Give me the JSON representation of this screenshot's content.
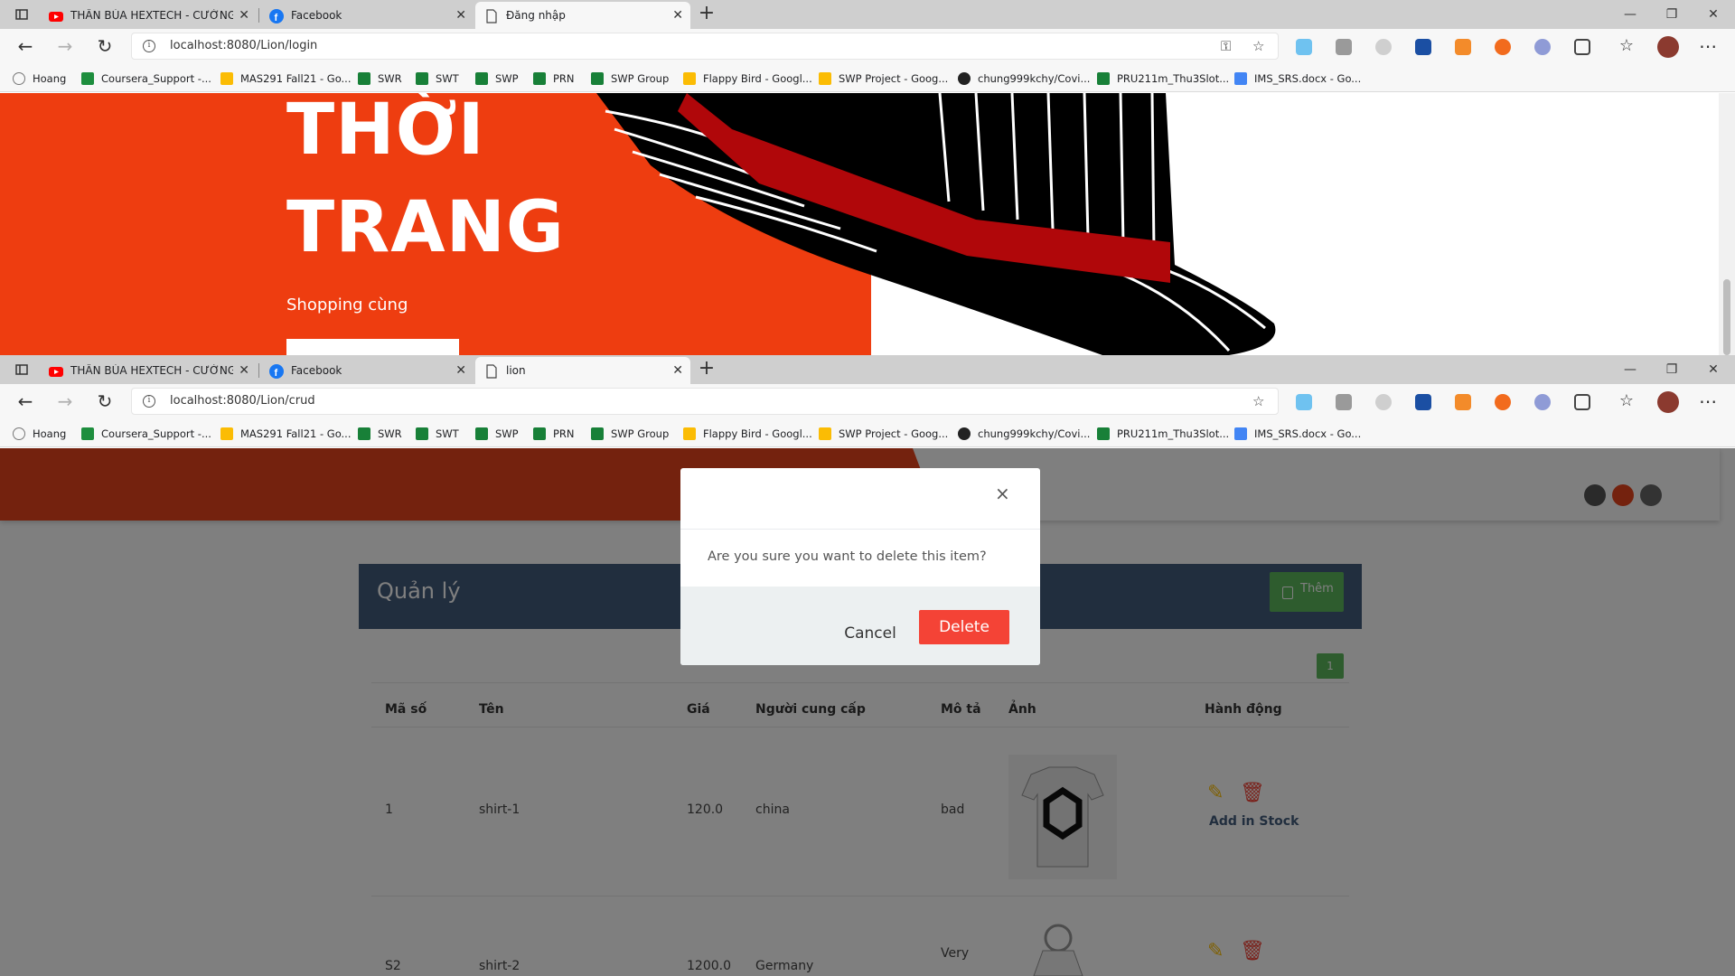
{
  "window1": {
    "tabs": [
      {
        "title": "THẦN BÚA HEXTECH - CƯỜNG ...",
        "icon": "youtube-icon"
      },
      {
        "title": "Facebook",
        "icon": "facebook-icon"
      },
      {
        "title": "Đăng nhập",
        "icon": "page-icon",
        "active": true
      }
    ],
    "url": "localhost:8080/Lion/login",
    "hero": {
      "line1": "THỜI",
      "line2": "TRANG",
      "subtitle": "Shopping cùng"
    }
  },
  "window2": {
    "tabs": [
      {
        "title": "THẦN BÚA HEXTECH - CƯỜNG ...",
        "icon": "youtube-icon"
      },
      {
        "title": "Facebook",
        "icon": "facebook-icon"
      },
      {
        "title": "lion",
        "icon": "page-icon",
        "active": true
      }
    ],
    "url": "localhost:8080/Lion/crud",
    "panel": {
      "title": "Quản lý",
      "add_label": "Thêm",
      "page": "1"
    },
    "table": {
      "headers": [
        "Mã số",
        "Tên",
        "Giá",
        "Người cung cấp",
        "Mô tả",
        "Ảnh",
        "Hành động"
      ],
      "rows": [
        {
          "id": "1",
          "name": "shirt-1",
          "price": "120.0",
          "supplier": "china",
          "desc": "bad",
          "action": "Add in Stock"
        },
        {
          "id": "S2",
          "name": "shirt-2",
          "price": "1200.0",
          "supplier": "Germany",
          "desc": "Very"
        }
      ]
    },
    "modal": {
      "message": "Are you sure you want to delete this item?",
      "cancel": "Cancel",
      "delete": "Delete",
      "close": "×"
    }
  },
  "bookmarks": [
    "Hoang",
    "Coursera_Support -...",
    "MAS291 Fall21 - Go...",
    "SWR",
    "SWT",
    "SWP",
    "PRN",
    "SWP Group",
    "Flappy Bird - Googl...",
    "SWP Project - Goog...",
    "chung999kchy/Covi...",
    "PRU211m_Thu3Slot...",
    "IMS_SRS.docx - Go..."
  ],
  "colors": {
    "accent": "#ee3d10",
    "panel": "#435d7d",
    "add": "#5cb85c",
    "delete": "#f44336"
  }
}
